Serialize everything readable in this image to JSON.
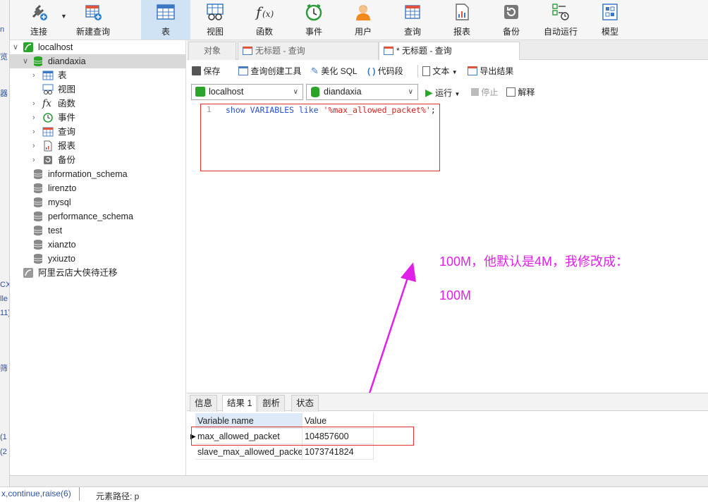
{
  "toolbar": {
    "buttons": [
      {
        "label": "连接",
        "icon": "plug-icon"
      },
      {
        "label": "新建查询",
        "icon": "new-query-icon"
      },
      {
        "label": "表",
        "icon": "table-icon"
      },
      {
        "label": "视图",
        "icon": "view-icon"
      },
      {
        "label": "函数",
        "icon": "function-icon"
      },
      {
        "label": "事件",
        "icon": "clock-icon"
      },
      {
        "label": "用户",
        "icon": "user-icon"
      },
      {
        "label": "查询",
        "icon": "query-icon"
      },
      {
        "label": "报表",
        "icon": "report-icon"
      },
      {
        "label": "备份",
        "icon": "backup-icon"
      },
      {
        "label": "自动运行",
        "icon": "auto-run-icon"
      },
      {
        "label": "模型",
        "icon": "model-icon"
      }
    ],
    "active": "表"
  },
  "left_strip": [
    "n",
    "览",
    "器",
    "CX",
    "lle",
    "11)",
    "筛",
    "(1",
    "(2"
  ],
  "tree": {
    "connection": "localhost",
    "database": "diandaxia",
    "children": [
      "表",
      "视图",
      "函数",
      "事件",
      "查询",
      "报表",
      "备份"
    ],
    "other_databases": [
      "information_schema",
      "lirenzto",
      "mysql",
      "performance_schema",
      "test",
      "xianzto",
      "yxiuzto"
    ],
    "other_connection": "阿里云店大侠待迁移"
  },
  "tabs": {
    "objects": "对象",
    "tab1": "无标题 - 查询",
    "tab2": "* 无标题 - 查询"
  },
  "edit_toolbar": {
    "save": "保存",
    "query_builder": "查询创建工具",
    "beautify": "美化 SQL",
    "snippet": "代码段",
    "text": "文本",
    "export": "导出结果"
  },
  "conn_bar": {
    "connection": "localhost",
    "database": "diandaxia",
    "run": "运行",
    "stop": "停止",
    "explain": "解释"
  },
  "editor": {
    "line_number": "1",
    "code_keyword": "show VARIABLES like ",
    "code_string": "'%max_allowed_packet%'",
    "code_end": ";"
  },
  "result_tabs": [
    "信息",
    "结果 1",
    "剖析",
    "状态"
  ],
  "result_active": "结果 1",
  "grid": {
    "columns": [
      "Variable name",
      "Value"
    ],
    "rows": [
      [
        "max_allowed_packet",
        "104857600"
      ],
      [
        "slave_max_allowed_packe",
        "1073741824"
      ]
    ]
  },
  "annotation": {
    "line1": "100M，他默认是4M，我修改成：",
    "line2": "100M"
  },
  "bottom_text": {
    "left": "x,continue,raise(6)",
    "right": "元素路径: p"
  },
  "colors": {
    "accent": "#cfe3f5",
    "highlight_box": "#e03030",
    "annotation": "#e020e8",
    "run_green": "#28a828",
    "db_green": "#2aa52a"
  }
}
